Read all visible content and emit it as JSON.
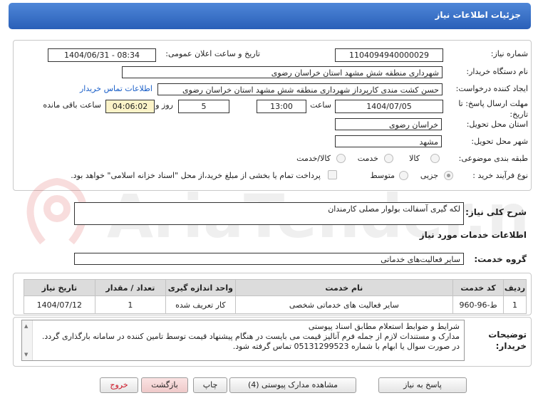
{
  "header": {
    "title": "جزئیات اطلاعات نیاز"
  },
  "form": {
    "need_number_label": "شماره نیاز:",
    "need_number": "1104094940000029",
    "announce_label": "تاریخ و ساعت اعلان عمومی:",
    "announce_value": "1404/06/31 - 08:34",
    "buyer_org_label": "نام دستگاه خریدار:",
    "buyer_org": "شهرداری منطقه شش مشهد استان خراسان رضوی",
    "creator_label": "ایجاد کننده درخواست:",
    "creator": "حسن کشت مندی کارپرداز شهرداری منطقه شش مشهد استان خراسان رضوی",
    "contact_link": "اطلاعات تماس خریدار",
    "deadline_label": "مهلت ارسال پاسخ: تا تاریخ:",
    "deadline_date": "1404/07/05",
    "time_label": "ساعت",
    "deadline_time": "13:00",
    "days": "5",
    "days_label": "روز و",
    "remaining": "04:06:02",
    "remaining_label": "ساعت باقی مانده",
    "province_label": "استان محل تحویل:",
    "province": "خراسان رضوی",
    "city_label": "شهر محل تحویل:",
    "city": "مشهد",
    "category_label": "طبقه بندی موضوعی:",
    "category_options": [
      "کالا",
      "خدمت",
      "کالا/خدمت"
    ],
    "process_label": "نوع فرآیند خرید :",
    "process_options": [
      "جزیی",
      "متوسط"
    ],
    "payment_note": "پرداخت تمام یا بخشی از مبلغ خرید،از محل \"اسناد خزانه اسلامی\" خواهد بود."
  },
  "description": {
    "label": "شرح کلی نیاز:",
    "value": "لکه گیری آسفالت بولوار مصلی کارمندان"
  },
  "services": {
    "section_title": "اطلاعات خدمات مورد نیاز",
    "group_label": "گروه خدمت:",
    "group_value": "سایر فعالیت‌های خدماتی",
    "columns": [
      "ردیف",
      "کد خدمت",
      "نام خدمت",
      "واحد اندازه گیری",
      "تعداد / مقدار",
      "تاریخ نیاز"
    ],
    "rows": [
      [
        "1",
        "ط-96-960",
        "سایر فعالیت های خدماتی شخصی",
        "کار تعریف شده",
        "1",
        "1404/07/12"
      ]
    ]
  },
  "buyer_notes": {
    "label": "توضیحات خریدار:",
    "lines": [
      "شرایط و ضوابط استعلام مطابق اسناد پیوستی",
      "مدارک و مستندات لازم از جمله فرم آنالیز قیمت می بایست در هنگام پیشنهاد قیمت توسط تامین کننده در سامانه بارگذاری گردد.",
      "در صورت سوال یا ابهام با شماره 05131299523 تماس گرفته شود."
    ]
  },
  "buttons": {
    "reply": "پاسخ به نیاز",
    "attachments": "مشاهده مدارک پیوستی (4)",
    "print": "چاپ",
    "back": "بازگشت",
    "exit": "خروج"
  },
  "watermark": {
    "text": "AriaTender.net"
  },
  "colors": {
    "title_bar": "#2a5fb8",
    "link": "#1a5fc8",
    "highlight": "#fcf3c8",
    "exit_text": "#cc1122"
  }
}
